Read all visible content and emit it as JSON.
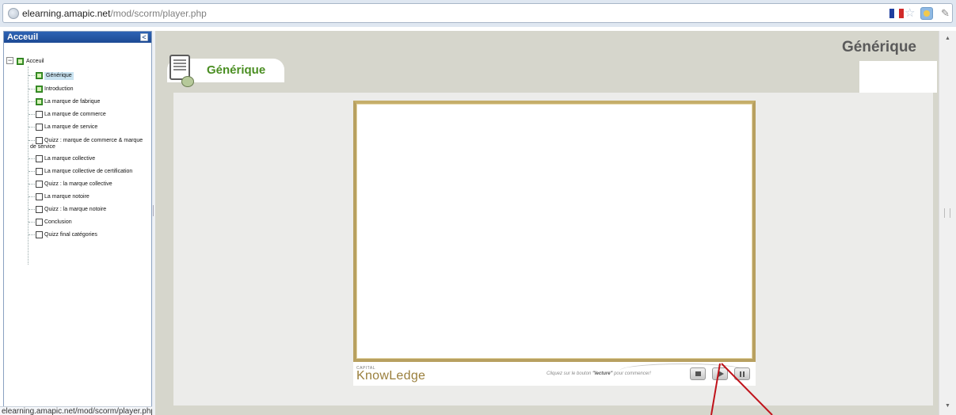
{
  "browser": {
    "url_host": "elearning.amapic.net",
    "url_path": "/mod/scorm/player.php",
    "icons": [
      "globe-icon",
      "flag-icon",
      "star-icon",
      "extension-icon",
      "wrench-icon"
    ],
    "flag_colors": [
      "#1f3f9f",
      "#ffffff",
      "#d12a2a"
    ]
  },
  "sidebar": {
    "header": "Acceuil",
    "collapse_glyph": "<",
    "root": {
      "label": "Acceuil",
      "done": true,
      "expander": "−"
    },
    "items": [
      {
        "label": "Générique",
        "done": true,
        "selected": true
      },
      {
        "label": "Introduction",
        "done": true
      },
      {
        "label": "La marque de fabrique",
        "done": true
      },
      {
        "label": "La marque de commerce",
        "done": false
      },
      {
        "label": "La marque de service",
        "done": false
      },
      {
        "label": "Quizz : marque de commerce & marque",
        "label2": "de service",
        "done": false
      },
      {
        "label": "La marque collective",
        "done": false
      },
      {
        "label": "La marque collective de certification",
        "done": false
      },
      {
        "label": "Quizz : la marque collective",
        "done": false
      },
      {
        "label": "La marque notoire",
        "done": false
      },
      {
        "label": "Quizz : la marque notoire",
        "done": false
      },
      {
        "label": "Conclusion",
        "done": false
      },
      {
        "label": "Quizz final catégories",
        "done": false
      }
    ]
  },
  "status_bar": "elearning.amapic.net/mod/scorm/player.php#",
  "main": {
    "page_title": "Générique",
    "tab_title": "Générique",
    "player": {
      "brand_small": "CAPITAL",
      "brand": "KnowLedge",
      "hint_pre": "Cliquez sur le bouton ",
      "hint_bold": "\"lecture\"",
      "hint_post": " pour commencer!",
      "buttons": [
        "stop-button",
        "play-button",
        "pause-button"
      ]
    }
  },
  "colors": {
    "accent_green": "#4a8e22",
    "frame_gold": "#b8a060",
    "arrow_red": "#c0121a"
  }
}
